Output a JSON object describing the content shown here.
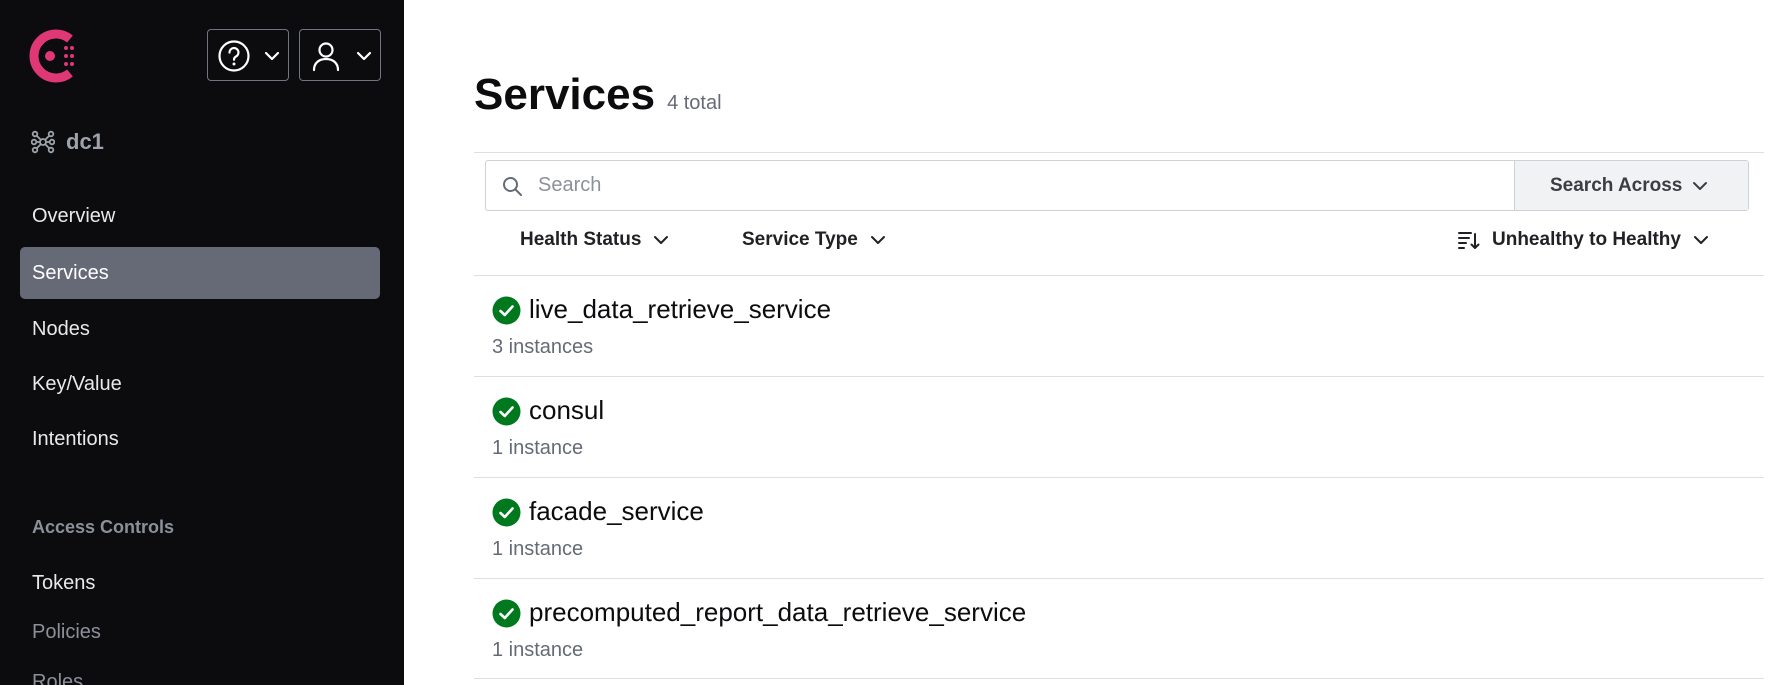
{
  "sidebar": {
    "datacenter": "dc1",
    "nav": [
      {
        "label": "Overview"
      },
      {
        "label": "Services"
      },
      {
        "label": "Nodes"
      },
      {
        "label": "Key/Value"
      },
      {
        "label": "Intentions"
      }
    ],
    "section_title": "Access Controls",
    "acl_items": [
      {
        "label": "Tokens"
      },
      {
        "label": "Policies"
      },
      {
        "label": "Roles"
      }
    ],
    "active_item": "Services"
  },
  "header": {
    "title": "Services",
    "count": "4 total"
  },
  "search": {
    "placeholder": "Search",
    "across_label": "Search Across"
  },
  "filters": {
    "health_status": "Health Status",
    "service_type": "Service Type",
    "sort": "Unhealthy to Healthy"
  },
  "services": [
    {
      "name": "live_data_retrieve_service",
      "instances": "3 instances",
      "status": "passing"
    },
    {
      "name": "consul",
      "instances": "1 instance",
      "status": "passing"
    },
    {
      "name": "facade_service",
      "instances": "1 instance",
      "status": "passing"
    },
    {
      "name": "precomputed_report_data_retrieve_service",
      "instances": "1 instance",
      "status": "passing"
    }
  ],
  "colors": {
    "sidebar_bg": "#0c0c0e",
    "active_nav": "#656a76",
    "brand": "#e03875",
    "passing": "#00781e"
  }
}
